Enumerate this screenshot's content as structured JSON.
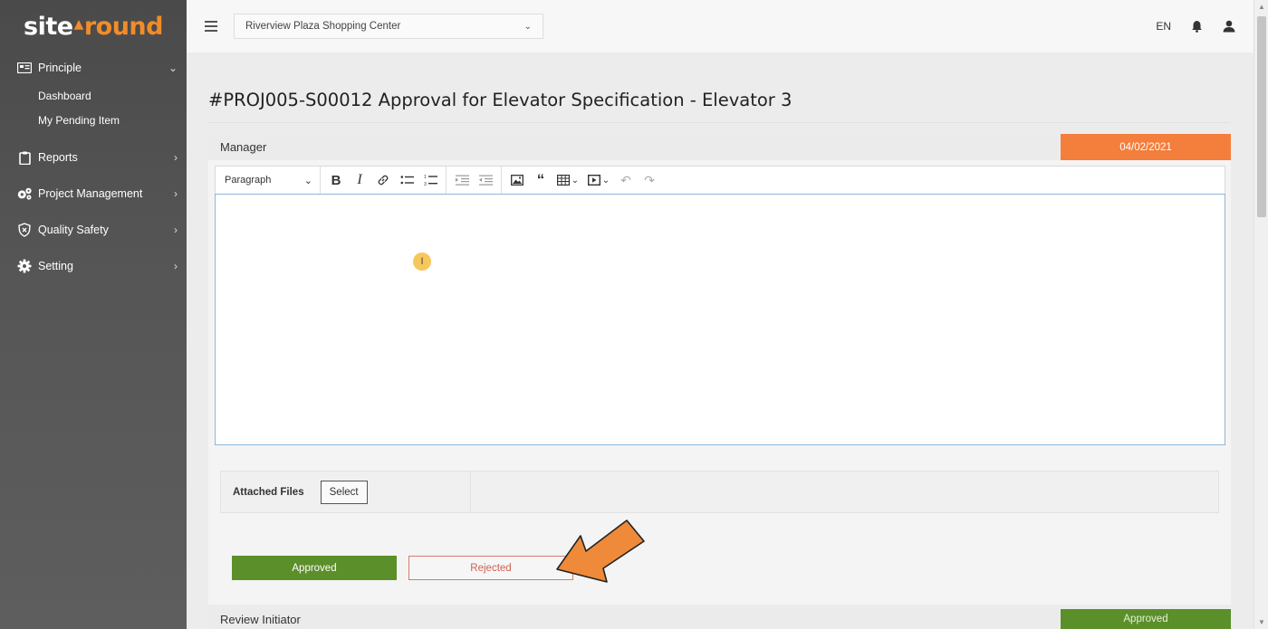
{
  "logo": {
    "part1": "site",
    "part2": "round"
  },
  "sidebar": {
    "principle": "Principle",
    "sub_items": [
      "Dashboard",
      "My Pending Item"
    ],
    "items": [
      {
        "label": "Reports",
        "icon": "clipboard-icon"
      },
      {
        "label": "Project Management",
        "icon": "gears-icon"
      },
      {
        "label": "Quality Safety",
        "icon": "shield-icon"
      },
      {
        "label": "Setting",
        "icon": "gear-icon"
      }
    ]
  },
  "topbar": {
    "project": "Riverview Plaza Shopping Center",
    "lang": "EN"
  },
  "page": {
    "title": "#PROJ005-S00012 Approval for Elevator Specification - Elevator 3"
  },
  "section": {
    "header": "Manager",
    "date": "04/02/2021"
  },
  "editor": {
    "paragraph": "Paragraph",
    "bold": "B",
    "italic": "I",
    "cursor": "I"
  },
  "attachments": {
    "label": "Attached Files",
    "select": "Select"
  },
  "actions": {
    "approved": "Approved",
    "rejected": "Rejected"
  },
  "section2": {
    "header": "Review Initiator",
    "status": "Approved"
  },
  "colors": {
    "accent_orange": "#f47e3c",
    "approve_green": "#5b8f2a",
    "reject_red": "#d06050",
    "arrow": "#ee8a3a"
  }
}
